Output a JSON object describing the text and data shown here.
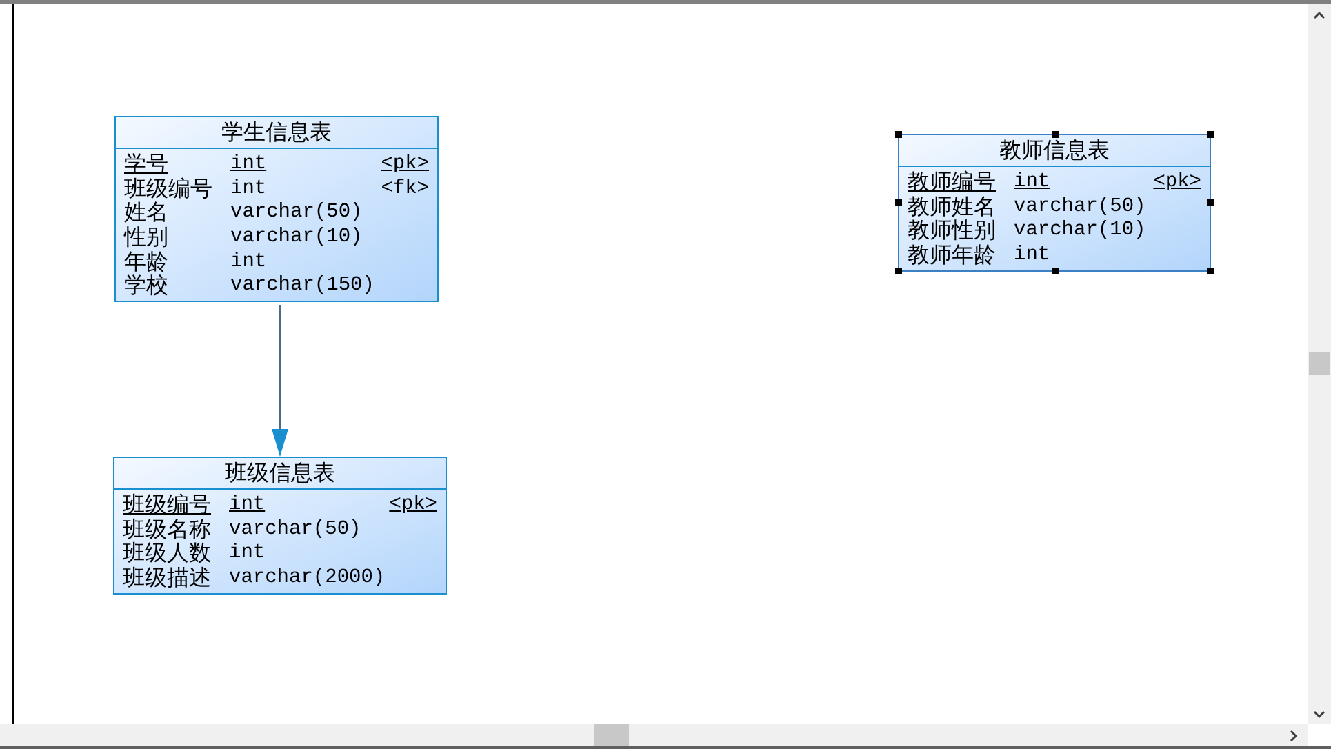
{
  "tables": [
    {
      "title": "学生信息表",
      "selected": false,
      "columns": [
        {
          "name": "学号",
          "type": "int",
          "key": "<pk>",
          "primary": true
        },
        {
          "name": "班级编号",
          "type": "int",
          "key": "<fk>",
          "primary": false
        },
        {
          "name": "姓名",
          "type": "varchar(50)",
          "primary": false
        },
        {
          "name": "性别",
          "type": "varchar(10)",
          "primary": false
        },
        {
          "name": "年龄",
          "type": "int",
          "primary": false
        },
        {
          "name": "学校",
          "type": "varchar(150)",
          "primary": false
        }
      ]
    },
    {
      "title": "班级信息表",
      "selected": false,
      "columns": [
        {
          "name": "班级编号",
          "type": "int",
          "key": "<pk>",
          "primary": true
        },
        {
          "name": "班级名称",
          "type": "varchar(50)",
          "primary": false
        },
        {
          "name": "班级人数",
          "type": "int",
          "primary": false
        },
        {
          "name": "班级描述",
          "type": "varchar(2000)",
          "primary": false
        }
      ]
    },
    {
      "title": "教师信息表",
      "selected": true,
      "columns": [
        {
          "name": "教师编号",
          "type": "int",
          "key": "<pk>",
          "primary": true
        },
        {
          "name": "教师姓名",
          "type": "varchar(50)",
          "primary": false
        },
        {
          "name": "教师性别",
          "type": "varchar(10)",
          "primary": false
        },
        {
          "name": "教师年龄",
          "type": "int",
          "primary": false
        }
      ]
    }
  ]
}
